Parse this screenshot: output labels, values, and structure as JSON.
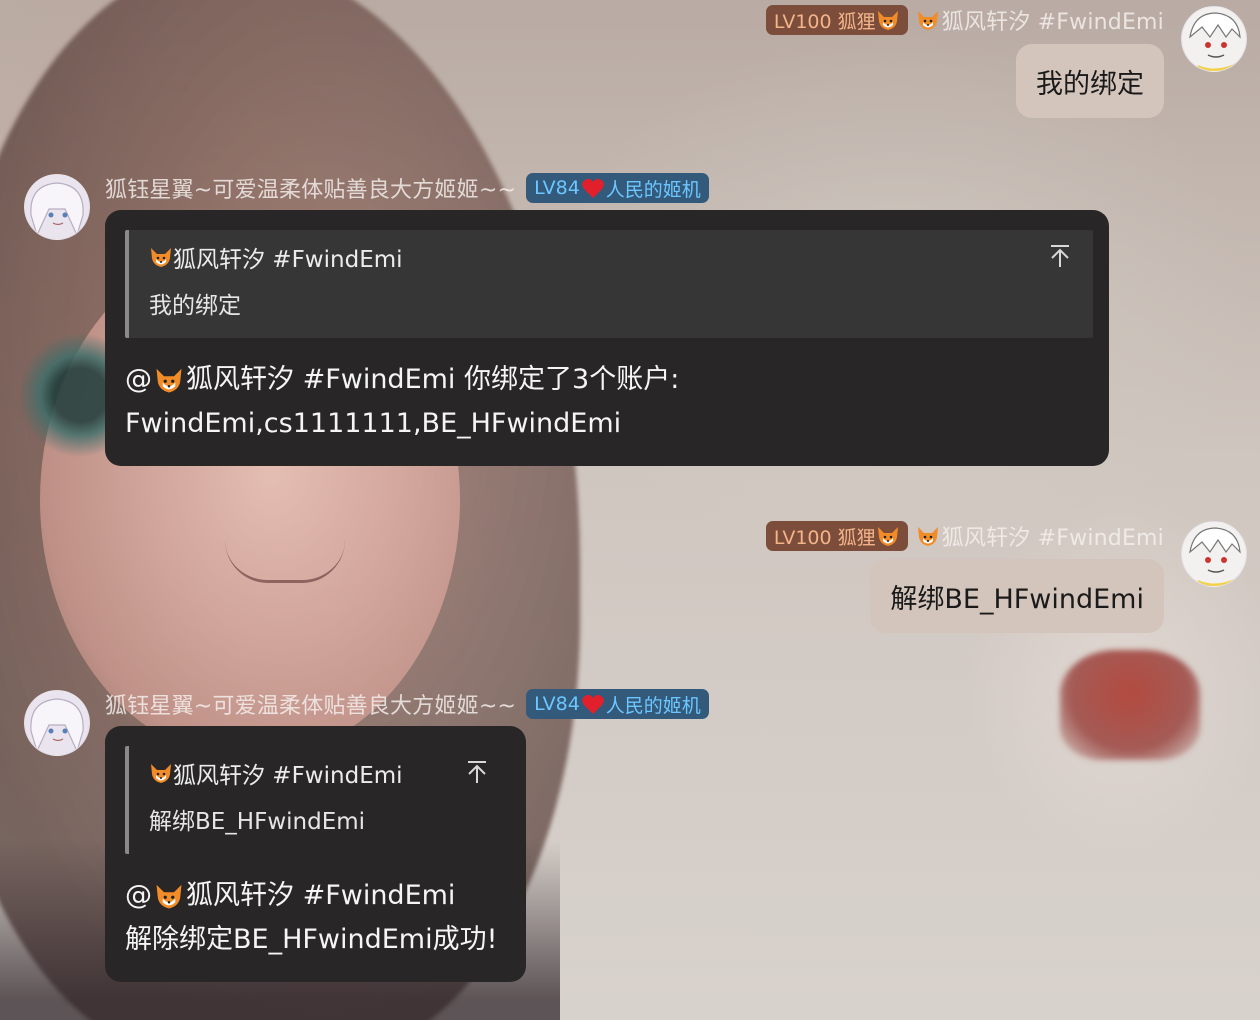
{
  "messages": [
    {
      "side": "right",
      "sender": {
        "level_badge": "LV100 狐狸",
        "name": "狐风轩汐 #FwindEmi"
      },
      "text": "我的绑定"
    },
    {
      "side": "left",
      "sender": {
        "name": "狐钰星翼~可爱温柔体贴善良大方姬姬~~",
        "level_badge": "LV84",
        "title_badge": "人民的姬机"
      },
      "quote": {
        "name": "狐风轩汐 #FwindEmi",
        "text": "我的绑定"
      },
      "reply_lines": [
        "@ 狐风轩汐 #FwindEmi 你绑定了3个账户:",
        "FwindEmi,cs1111111,BE_HFwindEmi"
      ],
      "reply_mention": "狐风轩汐 #FwindEmi 你绑定了3个账户:"
    },
    {
      "side": "right",
      "sender": {
        "level_badge": "LV100 狐狸",
        "name": "狐风轩汐 #FwindEmi"
      },
      "text": "解绑BE_HFwindEmi"
    },
    {
      "side": "left",
      "sender": {
        "name": "狐钰星翼~可爱温柔体贴善良大方姬姬~~",
        "level_badge": "LV84",
        "title_badge": "人民的姬机"
      },
      "quote": {
        "name": "狐风轩汐 #FwindEmi",
        "text": "解绑BE_HFwindEmi"
      },
      "reply_lines": [
        "@ 狐风轩汐 #FwindEmi",
        "解除绑定BE_HFwindEmi成功!"
      ],
      "reply_mention": "狐风轩汐 #FwindEmi"
    }
  ],
  "ui": {
    "at_sign": "@",
    "icons": {
      "fox": "fox-emoji-icon",
      "heart": "heart-emoji-icon",
      "jump": "jump-to-original-icon"
    },
    "colors": {
      "lv100_badge_bg": "#7b4d3a",
      "lv100_badge_text": "#f3b48a",
      "lv84_badge_bg": "#335a7a",
      "lv84_badge_text": "#6cc6ff",
      "bot_bubble_bg": "#282626",
      "own_bubble_bg": "#d4c5bc"
    }
  }
}
